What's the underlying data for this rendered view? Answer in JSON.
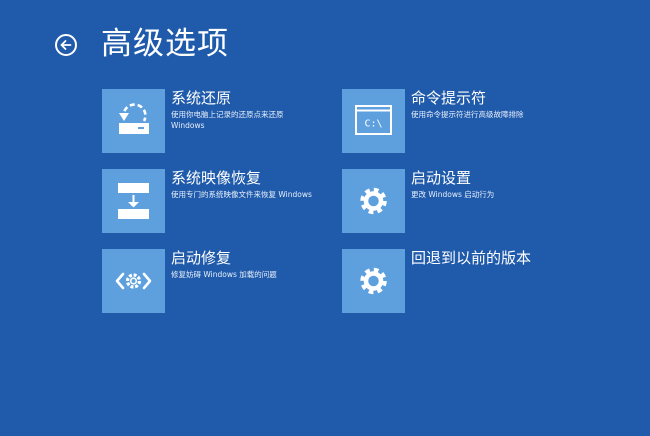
{
  "page": {
    "title": "高级选项"
  },
  "colors": {
    "background": "#1f5aab",
    "tile": "#5e9fde",
    "text": "#ffffff"
  },
  "options": [
    {
      "title": "系统还原",
      "description": "使用你电脑上记录的还原点来还原 Windows",
      "icon": "system-restore-icon"
    },
    {
      "title": "系统映像恢复",
      "description": "使用专门的系统映像文件来恢复 Windows",
      "icon": "system-image-recovery-icon"
    },
    {
      "title": "启动修复",
      "description": "修复妨碍 Windows 加载的问题",
      "icon": "startup-repair-icon"
    },
    {
      "title": "命令提示符",
      "description": "使用命令提示符进行高级故障排除",
      "icon": "command-prompt-icon",
      "icon_text": "C:\\"
    },
    {
      "title": "启动设置",
      "description": "更改 Windows 启动行为",
      "icon": "gear-icon"
    },
    {
      "title": "回退到以前的版本",
      "description": "",
      "icon": "gear-icon"
    }
  ]
}
